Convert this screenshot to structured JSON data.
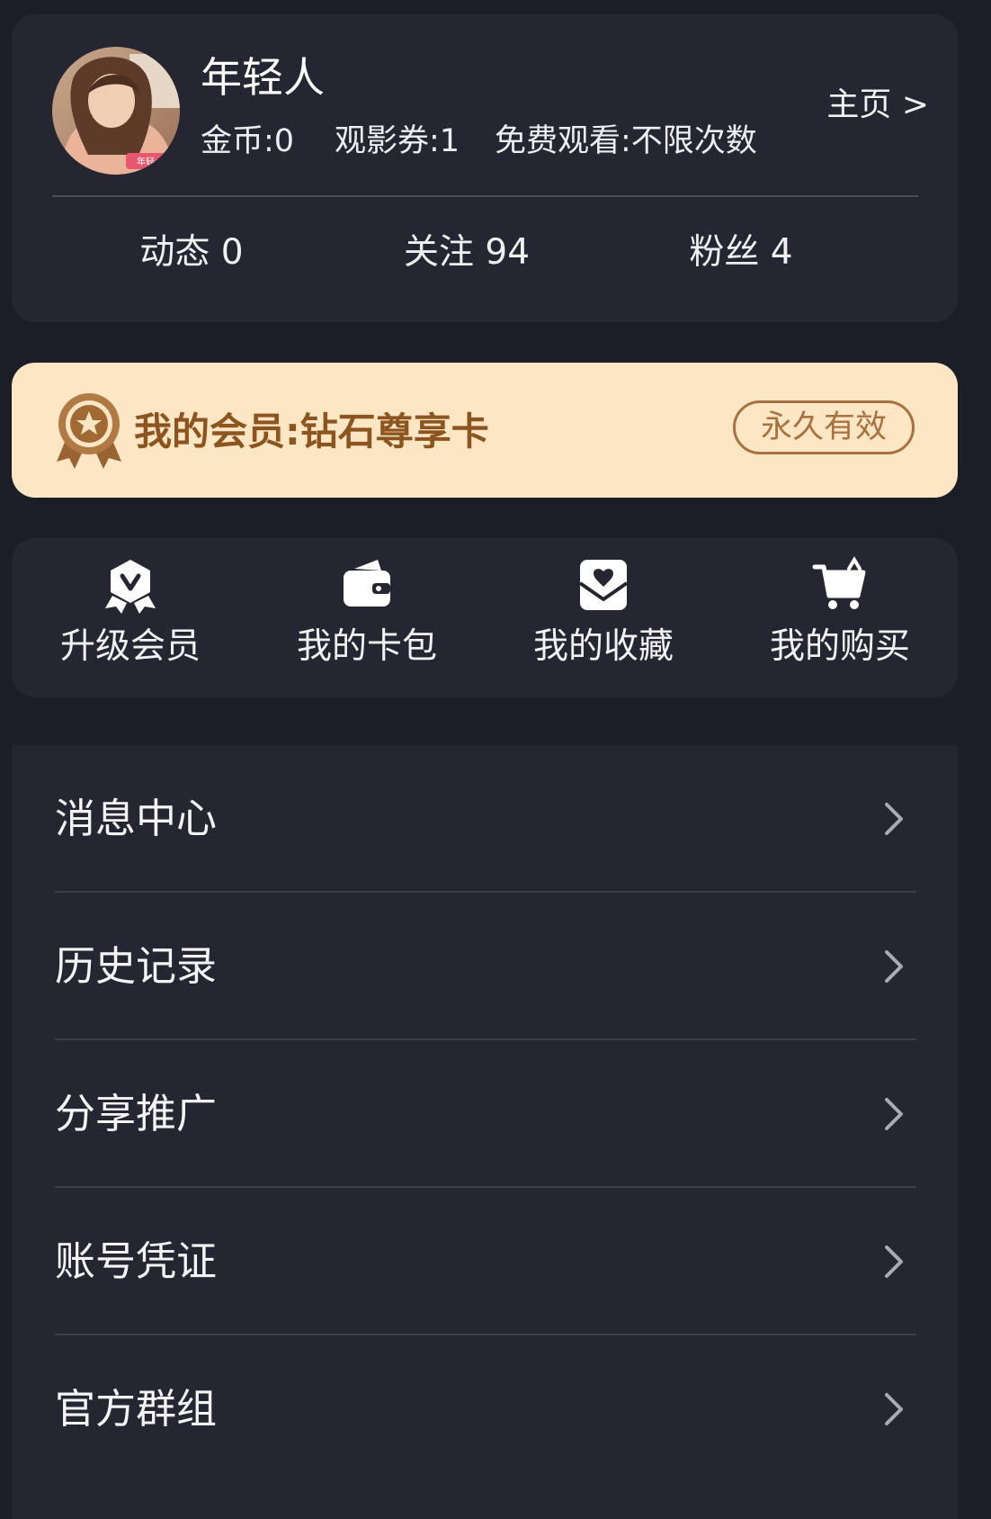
{
  "profile": {
    "username": "年轻人",
    "coins": "金币:0",
    "tickets": "观影券:1",
    "free_views": "免费观看:不限次数",
    "homepage_link": "主页 >",
    "avatar_badge": "年轻"
  },
  "social": [
    {
      "label": "动态 0"
    },
    {
      "label": "关注 94"
    },
    {
      "label": "粉丝 4"
    }
  ],
  "membership": {
    "title": "我的会员:钻石尊享卡",
    "validity": "永久有效",
    "background_color": "#fde6c4",
    "text_color": "#8c541f",
    "medal_icon": "medal-star-icon"
  },
  "quick_actions": [
    {
      "label": "升级会员",
      "icon": "vip-badge-icon"
    },
    {
      "label": "我的卡包",
      "icon": "wallet-icon"
    },
    {
      "label": "我的收藏",
      "icon": "heart-envelope-icon"
    },
    {
      "label": "我的购买",
      "icon": "shopping-cart-icon"
    }
  ],
  "menu": [
    {
      "label": "消息中心"
    },
    {
      "label": "历史记录"
    },
    {
      "label": "分享推广"
    },
    {
      "label": "账号凭证"
    },
    {
      "label": "官方群组"
    }
  ],
  "theme": {
    "page_background": "#1b1d27",
    "card_background": "#252631"
  }
}
